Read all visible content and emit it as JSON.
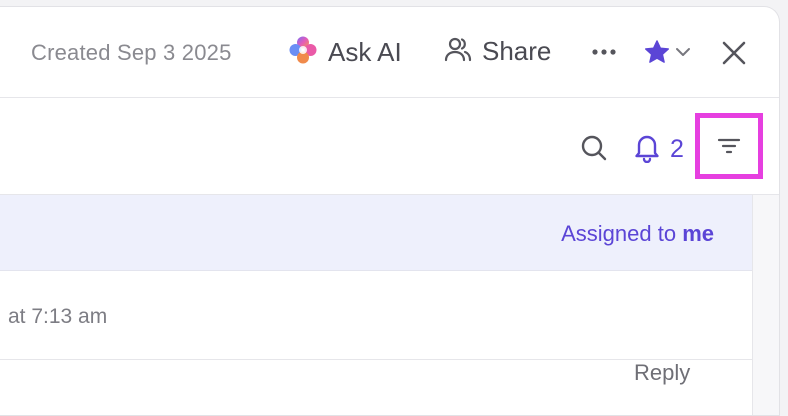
{
  "header": {
    "created": "Created Sep 3 2025",
    "ask_ai_label": "Ask AI",
    "share_label": "Share"
  },
  "toolbar": {
    "notification_count": "2"
  },
  "banner": {
    "assigned_prefix": "Assigned to ",
    "assigned_emphasis": "me"
  },
  "comment": {
    "timestamp": "at 7:13 am",
    "reply_label": "Reply"
  },
  "colors": {
    "accent": "#5b45d6",
    "highlight": "#e63fe0",
    "banner_bg": "#eef0fc"
  },
  "icons": [
    "ask-ai-sparkle-icon",
    "share-people-icon",
    "more-dots-icon",
    "star-icon",
    "chevron-down-icon",
    "close-icon",
    "search-icon",
    "bell-icon",
    "filter-icon"
  ]
}
